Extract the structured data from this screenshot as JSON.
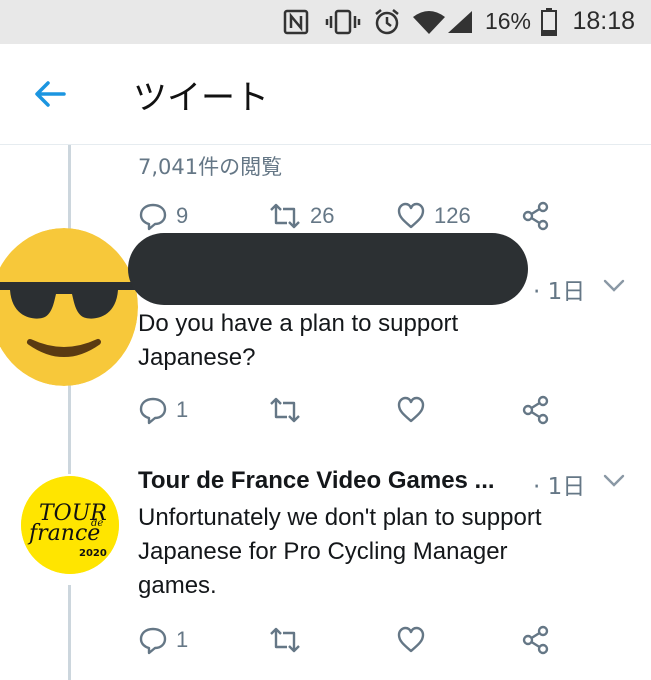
{
  "status_bar": {
    "battery": "16%",
    "time": "18:18"
  },
  "header": {
    "title": "ツイート"
  },
  "original": {
    "views": "7,041件の閲覧",
    "reply_count": "9",
    "retweet_count": "26",
    "like_count": "126"
  },
  "replies": [
    {
      "author": "",
      "time": "· 1日",
      "text": "Do you have a plan to support\nJapanese?",
      "reply_count": "1"
    },
    {
      "author": "Tour de France Video Games ...",
      "time": "· 1日",
      "text": "Unfortunately we don't plan to support\nJapanese for Pro Cycling Manager\ngames.",
      "reply_count": "1",
      "avatar_logo": {
        "line1": "TOUR",
        "line2": "de",
        "line3": "france",
        "year": "2020"
      }
    }
  ],
  "colors": {
    "accent": "#1b95e0",
    "secondary": "#657786",
    "logo_yellow": "#ffe500",
    "emoji_yellow": "#f7c83a"
  }
}
